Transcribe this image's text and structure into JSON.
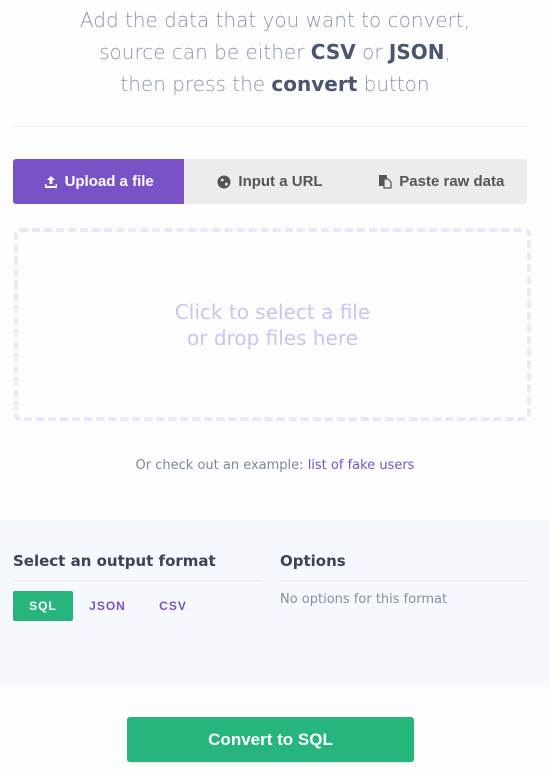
{
  "intro": {
    "line1": "Add the data that you want to convert,",
    "line2_pre": "source can be either ",
    "line2_csv": "CSV",
    "line2_mid": " or ",
    "line2_json": "JSON",
    "line2_post": ",",
    "line3_pre": "then press the ",
    "line3_bold": "convert",
    "line3_post": " button"
  },
  "tabs": [
    {
      "label": "Upload a file",
      "icon": "upload-icon",
      "active": true
    },
    {
      "label": "Input a URL",
      "icon": "globe-icon",
      "active": false
    },
    {
      "label": "Paste raw data",
      "icon": "paste-icon",
      "active": false
    }
  ],
  "dropzone": {
    "line1": "Click to select a file",
    "line2": "or drop files here"
  },
  "example": {
    "prefix": "Or check out an example: ",
    "link": "list of fake users"
  },
  "output": {
    "heading": "Select an output format",
    "formats": [
      {
        "label": "SQL",
        "active": true
      },
      {
        "label": "JSON",
        "active": false
      },
      {
        "label": "CSV",
        "active": false
      }
    ]
  },
  "options": {
    "heading": "Options",
    "empty": "No options for this format"
  },
  "convert_button": "Convert to SQL",
  "colors": {
    "accent": "#7a52c8",
    "success": "#26b57d"
  }
}
